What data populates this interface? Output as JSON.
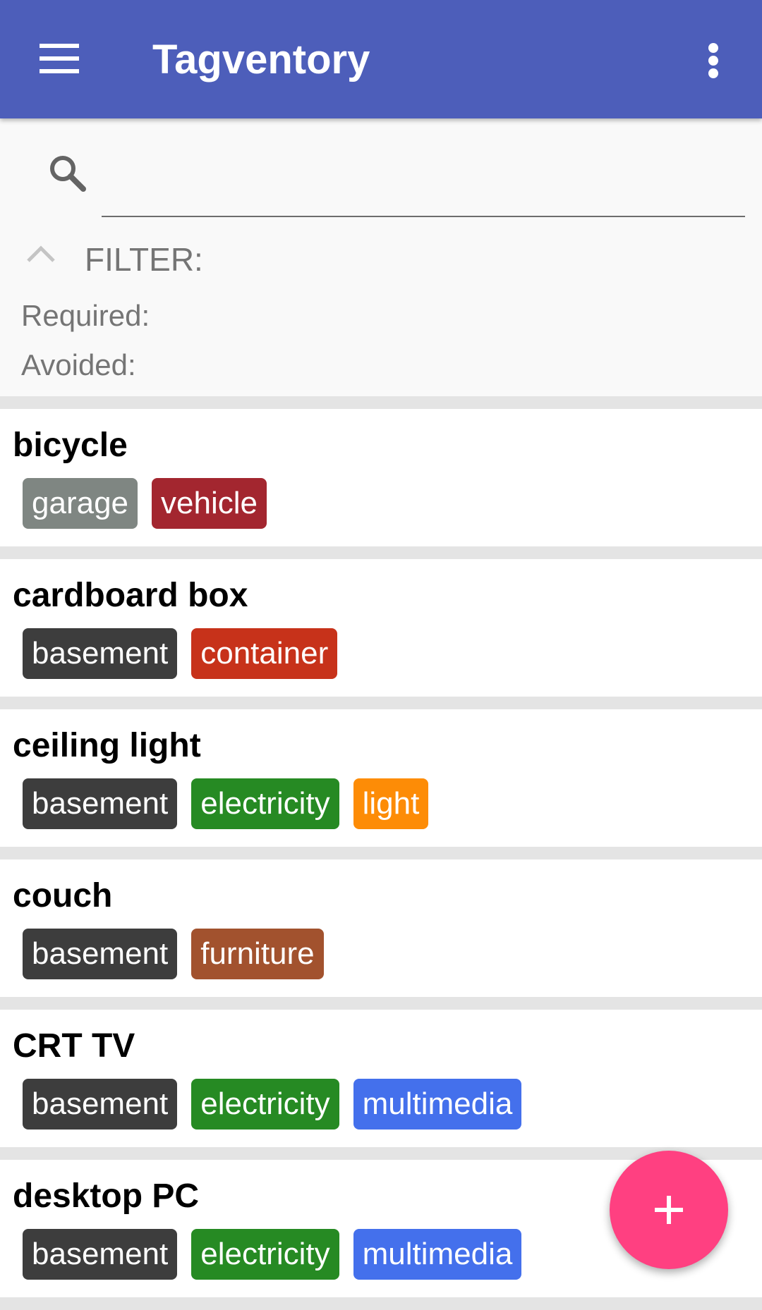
{
  "app_bar": {
    "title": "Tagventory",
    "menu_icon": "hamburger-menu-icon",
    "overflow_icon": "more-vert-icon",
    "color": "#4d5eba"
  },
  "search": {
    "value": "",
    "placeholder": "",
    "icon": "search-icon"
  },
  "filter": {
    "label": "FILTER:",
    "required_label": "Required:",
    "avoided_label": "Avoided:",
    "toggle_icon": "chevron-up-icon"
  },
  "items": [
    {
      "name": "bicycle",
      "tags": [
        {
          "label": "garage",
          "color": "#7f8682"
        },
        {
          "label": "vehicle",
          "color": "#a3262f"
        }
      ]
    },
    {
      "name": "cardboard box",
      "tags": [
        {
          "label": "basement",
          "color": "#3d3d3d"
        },
        {
          "label": "container",
          "color": "#c7321a"
        }
      ]
    },
    {
      "name": "ceiling light",
      "tags": [
        {
          "label": "basement",
          "color": "#3d3d3d"
        },
        {
          "label": "electricity",
          "color": "#268a23"
        },
        {
          "label": "light",
          "color": "#fd8c06"
        }
      ]
    },
    {
      "name": "couch",
      "tags": [
        {
          "label": "basement",
          "color": "#3d3d3d"
        },
        {
          "label": "furniture",
          "color": "#a2522e"
        }
      ]
    },
    {
      "name": "CRT TV",
      "tags": [
        {
          "label": "basement",
          "color": "#3d3d3d"
        },
        {
          "label": "electricity",
          "color": "#268a23"
        },
        {
          "label": "multimedia",
          "color": "#4470ec"
        }
      ]
    },
    {
      "name": "desktop PC",
      "tags": [
        {
          "label": "basement",
          "color": "#3d3d3d"
        },
        {
          "label": "electricity",
          "color": "#268a23"
        },
        {
          "label": "multimedia",
          "color": "#4470ec"
        }
      ]
    }
  ],
  "fab": {
    "icon": "plus-icon",
    "color": "#ff4081"
  }
}
